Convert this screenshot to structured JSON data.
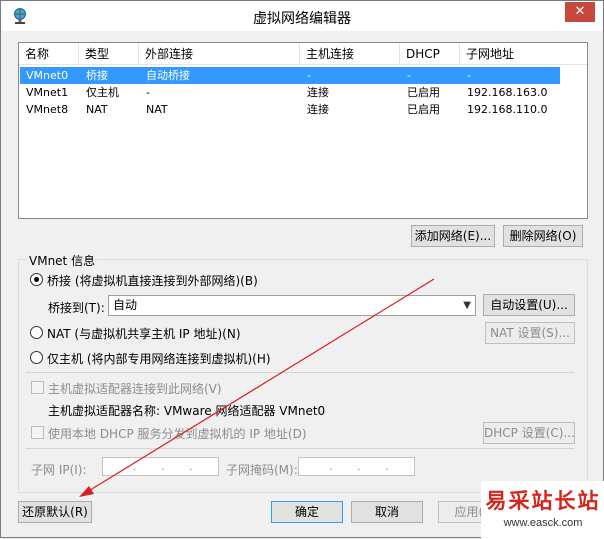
{
  "window": {
    "title": "虚拟网络编辑器",
    "close_glyph": "✕"
  },
  "table": {
    "headers": [
      "名称",
      "类型",
      "外部连接",
      "主机连接",
      "DHCP",
      "子网地址"
    ],
    "rows": [
      [
        "VMnet0",
        "桥接",
        "自动桥接",
        "-",
        "-",
        "-"
      ],
      [
        "VMnet1",
        "仅主机",
        "-",
        "连接",
        "已启用",
        "192.168.163.0"
      ],
      [
        "VMnet8",
        "NAT",
        "NAT",
        "连接",
        "已启用",
        "192.168.110.0"
      ]
    ],
    "selected_row": 0
  },
  "list_buttons": {
    "add": "添加网络(E)...",
    "remove": "删除网络(O)"
  },
  "vmnet_info": {
    "group_label": "VMnet 信息",
    "bridge_radio": "桥接 (将虚拟机直接连接到外部网络)(B)",
    "bridge_to_label": "桥接到(T):",
    "bridge_to_value": "自动",
    "auto_settings_button": "自动设置(U)...",
    "nat_radio": "NAT (与虚拟机共享主机 IP 地址)(N)",
    "nat_settings_button": "NAT 设置(S)...",
    "host_only_radio": "仅主机 (将内部专用网络连接到虚拟机)(H)",
    "connect_adapter_checkbox": "主机虚拟适配器连接到此网络(V)",
    "adapter_name_text": "主机虚拟适配器名称: VMware 网络适配器 VMnet0",
    "dhcp_checkbox": "使用本地 DHCP 服务分发到虚拟机的 IP 地址(D)",
    "dhcp_settings_button": "DHCP 设置(C)...",
    "subnet_ip_label": "子网 IP(I):",
    "subnet_mask_label": "子网掩码(M):",
    "ip_dots": ".",
    "selected_mode": "bridge"
  },
  "footer": {
    "restore_button": "还原默认(R)",
    "ok_button": "确定",
    "cancel_button": "取消",
    "apply_button": "应用(A"
  },
  "watermark": {
    "title": "易采站长站",
    "url": "www.easck.com"
  },
  "colors": {
    "selection": "#3399ff",
    "close": "#c7493d",
    "annotation_arrow": "#d62020",
    "watermark": "#d4261c"
  },
  "icons": {
    "app": "network-globe-icon",
    "dropdown": "chevron-down-icon"
  }
}
